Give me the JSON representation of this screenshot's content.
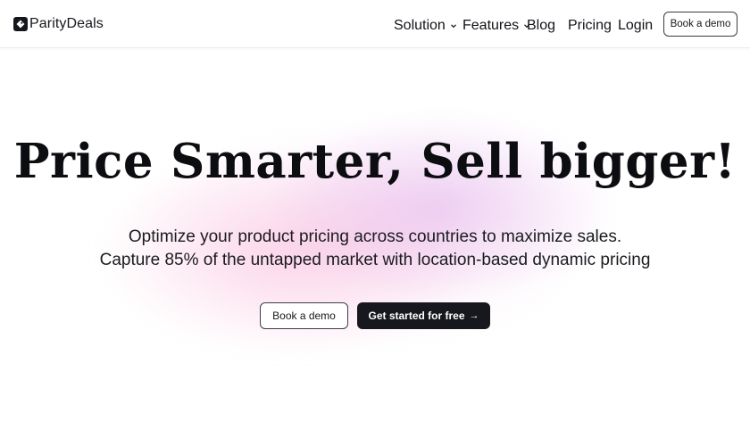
{
  "brand": {
    "name": "ParityDeals"
  },
  "nav": {
    "solution": "Solution",
    "features": "Features",
    "blog": "Blog",
    "pricing": "Pricing",
    "login": "Login",
    "cta": "Book a demo"
  },
  "hero": {
    "title": "Price Smarter, Sell bigger!",
    "subtitle_line1": "Optimize your product pricing across countries to maximize sales.",
    "subtitle_line2": "Capture 85% of the untapped market with location-based dynamic pricing",
    "secondary_cta": "Book a demo",
    "primary_cta": "Get started for free",
    "primary_cta_icon": "arrow-right-icon"
  },
  "colors": {
    "primary_button": "#17181d",
    "glow_pink": "#fabedc",
    "glow_violet": "#e2b0ec"
  }
}
